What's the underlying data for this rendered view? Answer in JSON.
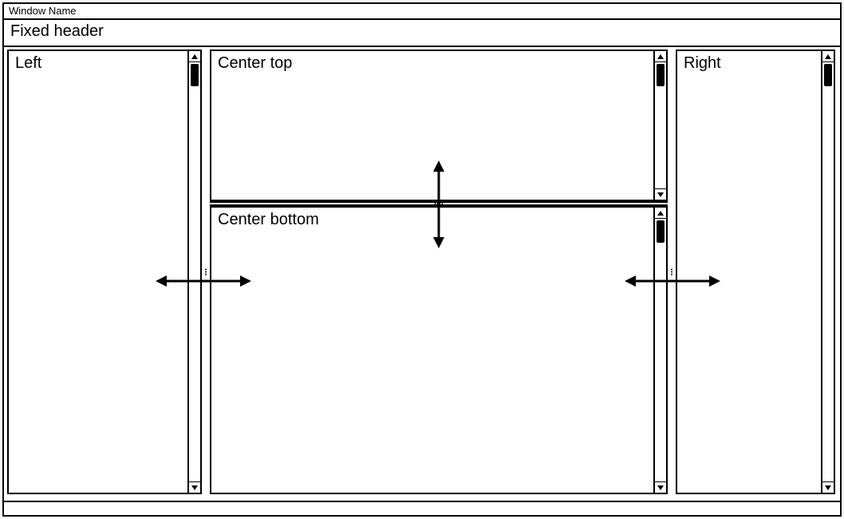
{
  "window": {
    "title": "Window Name"
  },
  "header": {
    "title": "Fixed header"
  },
  "panels": {
    "left": {
      "label": "Left"
    },
    "right": {
      "label": "Right"
    },
    "ctop": {
      "label": "Center top"
    },
    "cbot": {
      "label": "Center bottom"
    }
  }
}
